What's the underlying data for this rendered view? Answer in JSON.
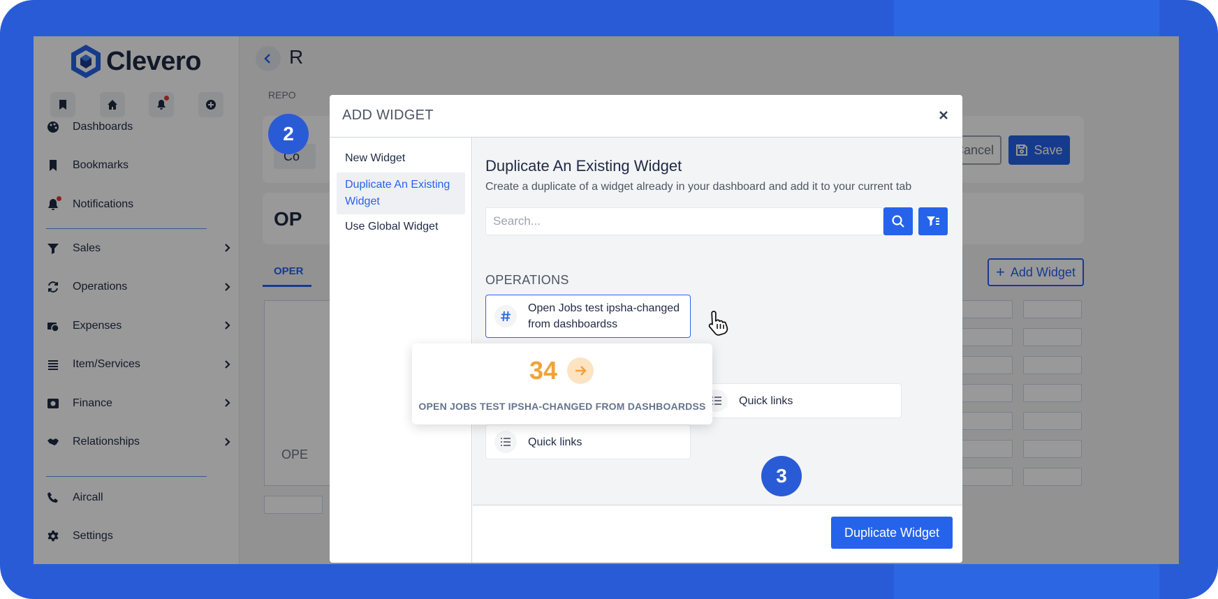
{
  "colors": {
    "frame": "#2a5bd7",
    "accent": "#2563eb",
    "preview_value": "#f0a23a"
  },
  "brand": {
    "name": "Clevero",
    "icon": "cube-logo-icon"
  },
  "quick_actions": [
    {
      "icon": "bookmark-icon"
    },
    {
      "icon": "home-icon"
    },
    {
      "icon": "bell-icon",
      "has_dot": true
    },
    {
      "icon": "plus-circle-icon"
    }
  ],
  "sidebar": {
    "group1": [
      {
        "label": "Dashboards",
        "icon": "palette-icon"
      },
      {
        "label": "Bookmarks",
        "icon": "bookmark-icon"
      },
      {
        "label": "Notifications",
        "icon": "bell-icon"
      }
    ],
    "group2": [
      {
        "label": "Sales",
        "icon": "sales-icon"
      },
      {
        "label": "Operations",
        "icon": "sync-icon"
      },
      {
        "label": "Expenses",
        "icon": "money-icon"
      },
      {
        "label": "Item/Services",
        "icon": "list-icon"
      },
      {
        "label": "Finance",
        "icon": "finance-icon"
      },
      {
        "label": "Relationships",
        "icon": "handshake-icon"
      }
    ],
    "group3": [
      {
        "label": "Aircall",
        "icon": "phone-icon"
      },
      {
        "label": "Settings",
        "icon": "gear-icon"
      }
    ]
  },
  "background": {
    "title": "R",
    "subtitle": "REPO",
    "field_label": "D",
    "field_value": "Co",
    "cancel_label": "Cancel",
    "save_label": "Save",
    "card_title": "OP",
    "tab_label": "OPER",
    "add_widget_label": "Add Widget",
    "widget_title": "OPE"
  },
  "modal": {
    "title": "ADD WIDGET",
    "options": [
      "New Widget",
      "Duplicate An Existing Widget",
      "Use Global Widget"
    ],
    "body_title": "Duplicate An Existing Widget",
    "body_desc": "Create a duplicate of a widget already in your dashboard and add it to your current tab",
    "search_placeholder": "Search...",
    "section": "OPERATIONS",
    "widgets": [
      {
        "label": "Open Jobs test ipsha-changed from dashboardss",
        "icon": "hash-icon",
        "selected": true
      },
      {
        "label": "Quick links",
        "icon": "list-icon",
        "selected": false
      },
      {
        "label": "Quick links",
        "icon": "list-icon",
        "selected": false
      }
    ],
    "preview": {
      "value": "34",
      "label": "OPEN JOBS TEST IPSHA-CHANGED FROM DASHBOARDSS"
    },
    "action_label": "Duplicate Widget"
  },
  "steps": [
    "2",
    "3"
  ]
}
